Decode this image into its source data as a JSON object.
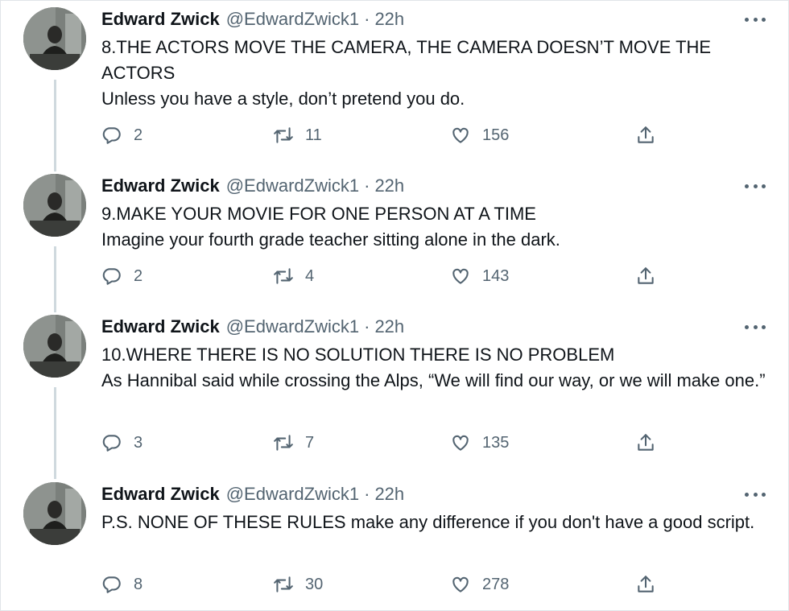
{
  "tweets": [
    {
      "name": "Edward Zwick",
      "handle": "@EdwardZwick1",
      "separator": "·",
      "time": "22h",
      "lines": [
        "8.THE ACTORS MOVE THE CAMERA, THE CAMERA DOESN’T MOVE THE ACTORS",
        "Unless you have a style, don’t pretend you do."
      ],
      "replies": "2",
      "retweets": "11",
      "likes": "156"
    },
    {
      "name": "Edward Zwick",
      "handle": "@EdwardZwick1",
      "separator": "·",
      "time": "22h",
      "lines": [
        "9.MAKE YOUR MOVIE FOR ONE PERSON AT A TIME",
        "Imagine your fourth grade teacher sitting alone in the dark."
      ],
      "replies": "2",
      "retweets": "4",
      "likes": "143"
    },
    {
      "name": "Edward Zwick",
      "handle": "@EdwardZwick1",
      "separator": "·",
      "time": "22h",
      "lines": [
        "10.WHERE THERE IS NO SOLUTION THERE IS NO PROBLEM",
        "As Hannibal said while crossing the Alps, “We will find our way, or we will make one.”"
      ],
      "replies": "3",
      "retweets": "7",
      "likes": "135"
    },
    {
      "name": "Edward Zwick",
      "handle": "@EdwardZwick1",
      "separator": "·",
      "time": "22h",
      "lines": [
        "P.S. NONE OF THESE RULES make any difference if you don't have a good script."
      ],
      "replies": "8",
      "retweets": "30",
      "likes": "278"
    }
  ],
  "icons": {
    "reply": "reply-icon",
    "retweet": "retweet-icon",
    "like": "heart-icon",
    "share": "share-icon",
    "more": "more-icon"
  },
  "colors": {
    "text": "#0f1419",
    "secondary": "#536471",
    "thread_line": "#cfd9de"
  }
}
